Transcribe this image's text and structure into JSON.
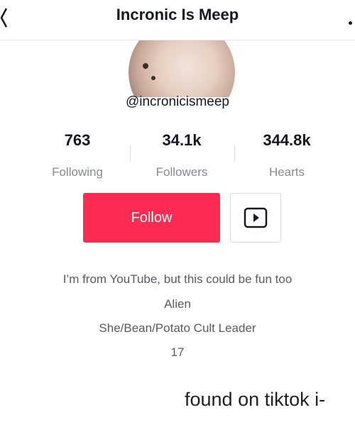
{
  "header": {
    "title": "Incronic Is Meep"
  },
  "profile": {
    "username": "@incronicismeep"
  },
  "stats": [
    {
      "value": "763",
      "label": "Following"
    },
    {
      "value": "34.1k",
      "label": "Followers"
    },
    {
      "value": "344.8k",
      "label": "Hearts"
    }
  ],
  "actions": {
    "follow_label": "Follow",
    "youtube_icon": "play-icon"
  },
  "bio": [
    "I’m from YouTube, but this could be fun too",
    "Alien",
    "She/Bean/Potato Cult Leader",
    "17"
  ],
  "caption": "found on tiktok i-",
  "colors": {
    "follow": "#fe2c55",
    "text": "#161823",
    "muted": "#8a8b91"
  }
}
